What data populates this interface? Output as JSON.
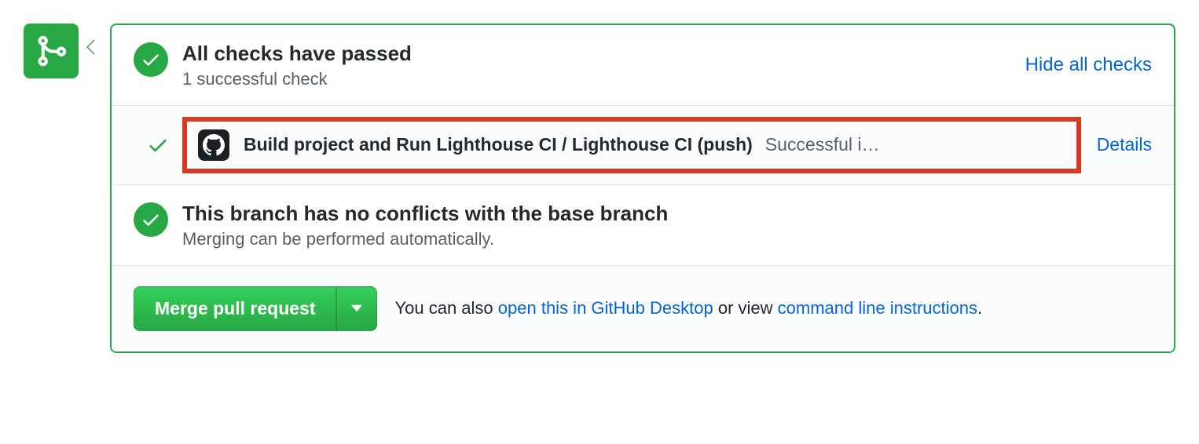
{
  "checks": {
    "title": "All checks have passed",
    "subtitle": "1 successful check",
    "toggle_link": "Hide all checks",
    "items": [
      {
        "name": "Build project and Run Lighthouse CI / Lighthouse CI (push)",
        "status": "Successful i…",
        "details_label": "Details"
      }
    ]
  },
  "conflicts": {
    "title": "This branch has no conflicts with the base branch",
    "subtitle": "Merging can be performed automatically."
  },
  "merge": {
    "button": "Merge pull request",
    "text_prefix": "You can also ",
    "link_desktop": "open this in GitHub Desktop",
    "text_middle": " or view ",
    "link_cli": "command line instructions",
    "text_suffix": "."
  }
}
